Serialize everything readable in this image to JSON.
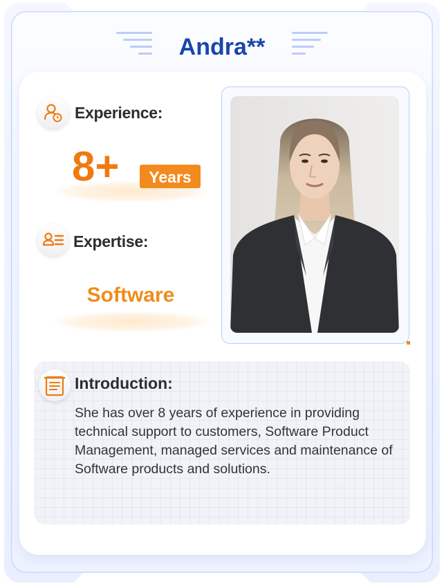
{
  "profile": {
    "name": "Andra**",
    "experience_label": "Experience:",
    "experience_value": "8+",
    "experience_unit": "Years",
    "expertise_label": "Expertise:",
    "expertise_value": "Software",
    "intro_title": "Introduction:",
    "intro_text": "She has over 8 years of experience in providing technical support to customers, Software Product Management, managed services and maintenance of Software products and solutions."
  },
  "icons": {
    "experience": "person-clock-icon",
    "expertise": "person-list-icon",
    "introduction": "document-icon"
  },
  "colors": {
    "name": "#1a46a8",
    "accent_orange": "#f07a10",
    "badge": "#f38a1d"
  }
}
